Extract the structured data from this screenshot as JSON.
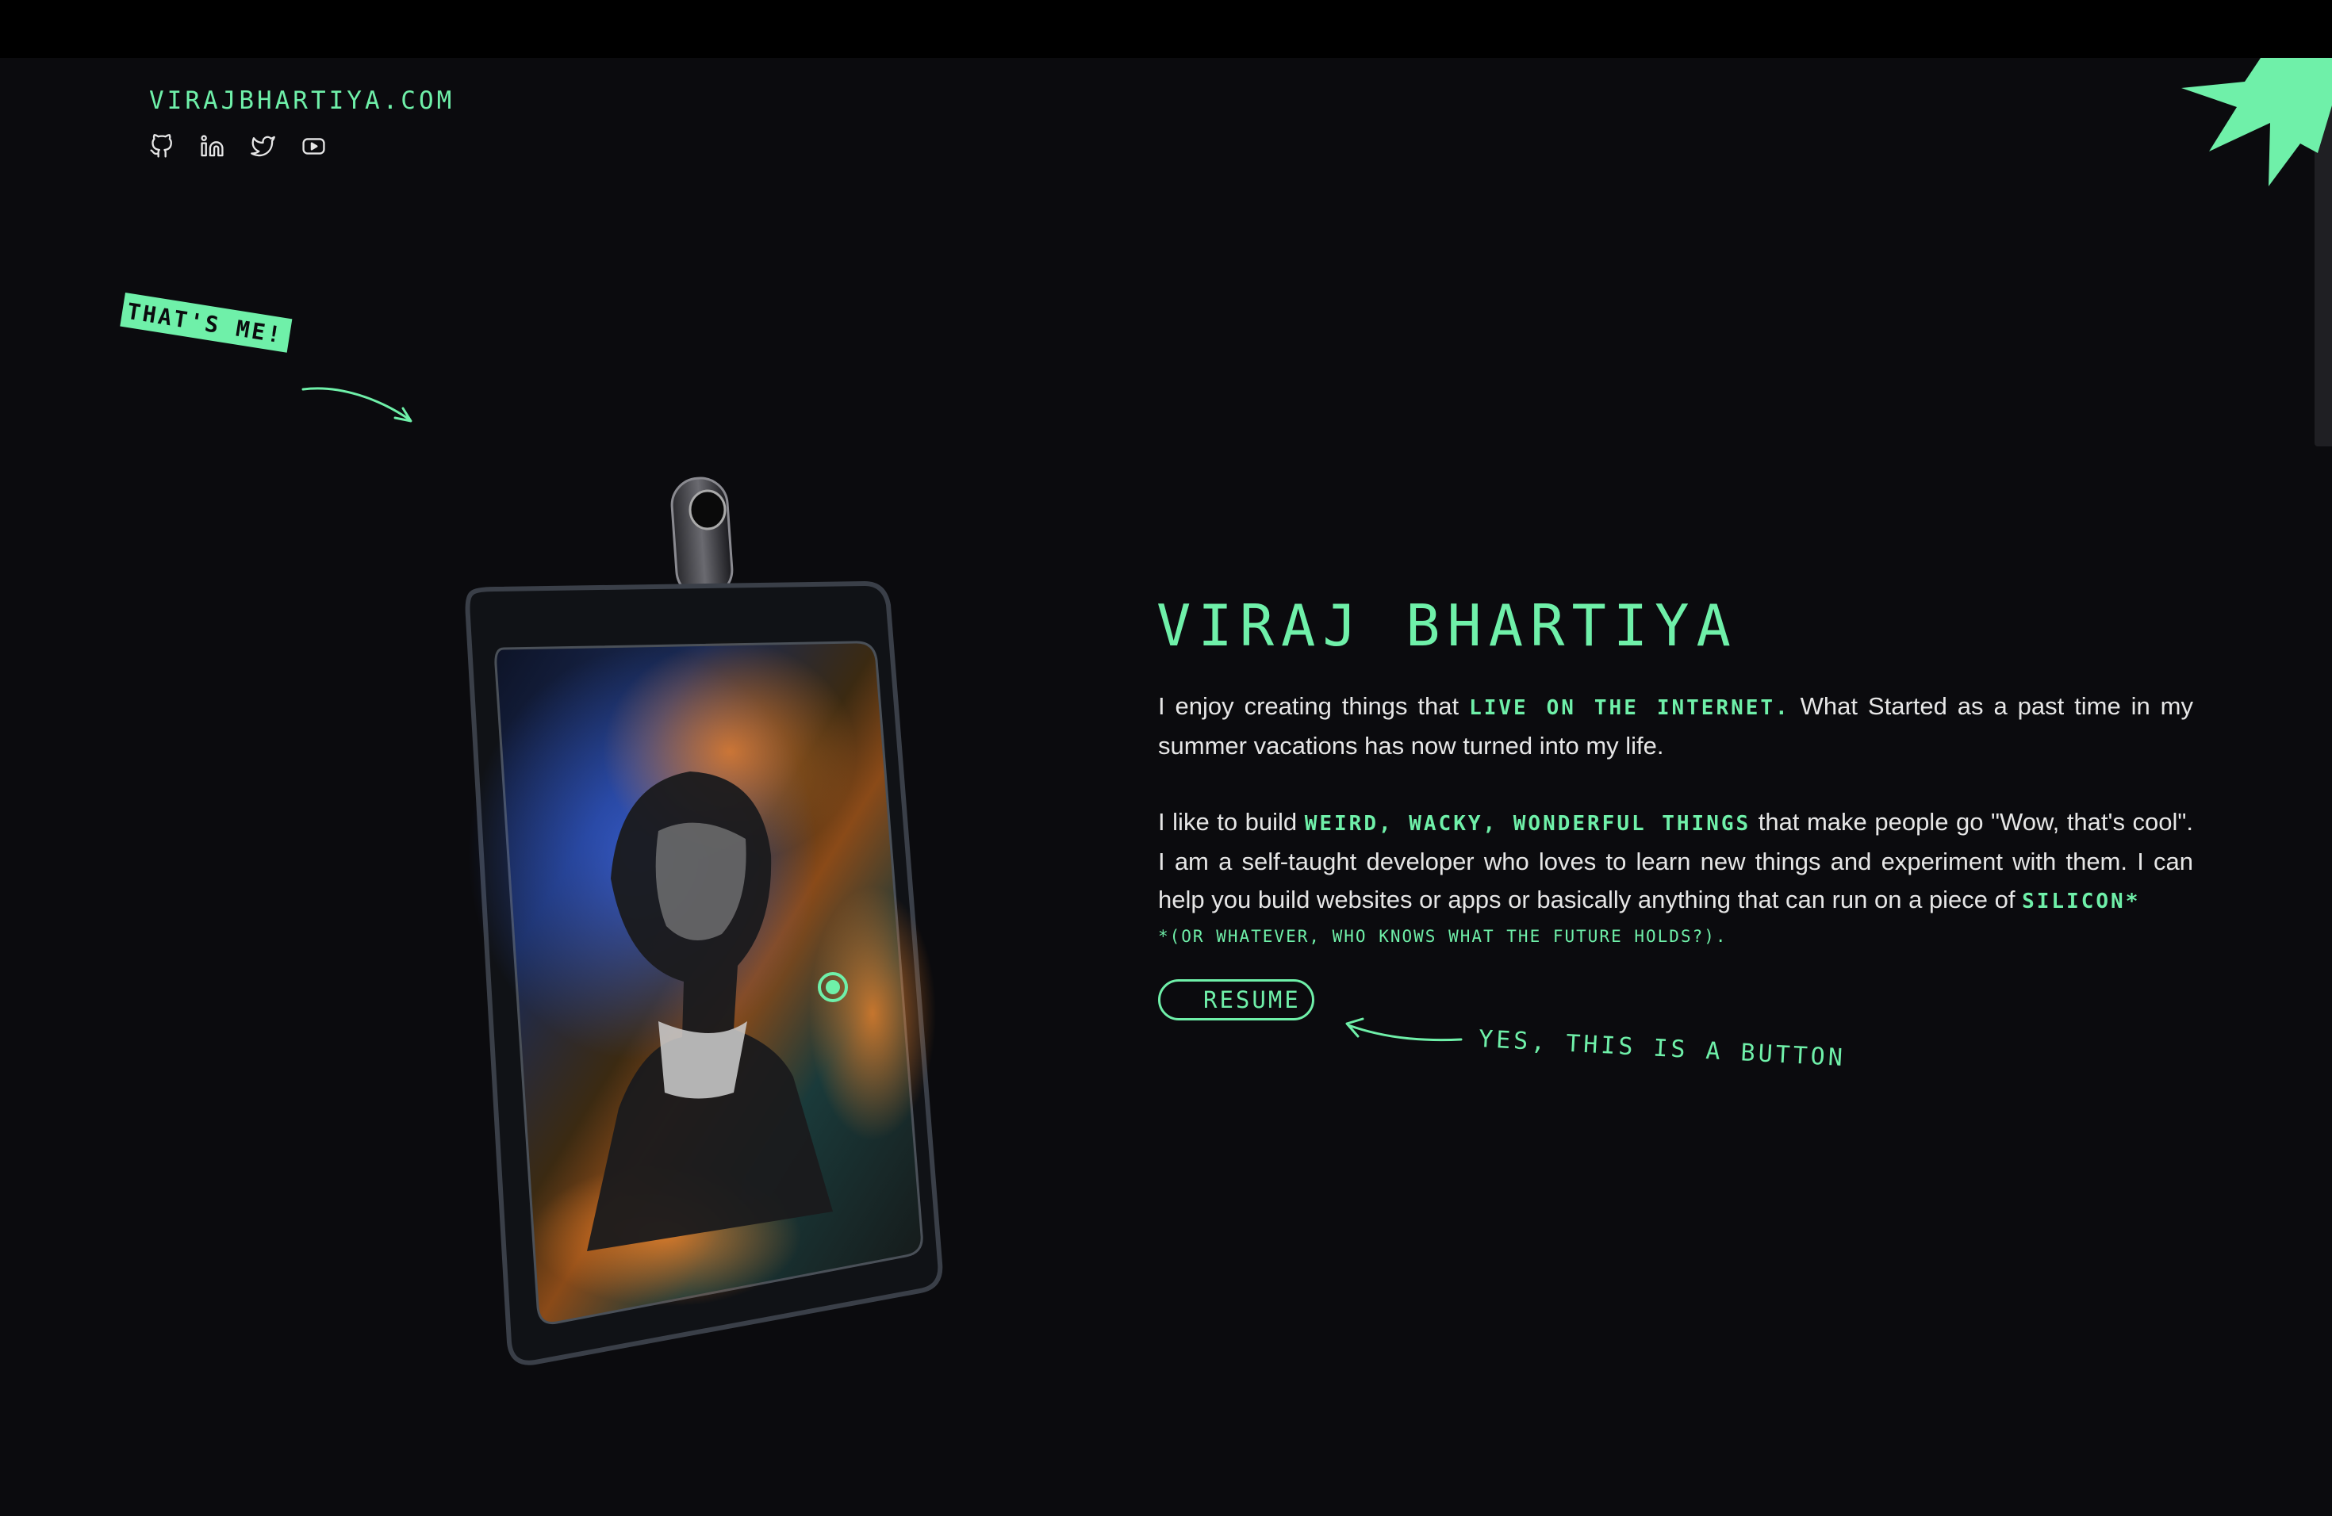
{
  "header": {
    "site_title": "VIRAJBHARTIYA.COM",
    "socials": [
      {
        "icon": "github-icon"
      },
      {
        "icon": "linkedin-icon"
      },
      {
        "icon": "twitter-icon"
      },
      {
        "icon": "youtube-icon"
      }
    ]
  },
  "annotations": {
    "thats_me": "THAT'S ME!",
    "button_note": "YES, THIS IS A BUTTON"
  },
  "intro": {
    "name": "VIRAJ BHARTIYA",
    "p1": {
      "before": "I enjoy creating things that ",
      "highlight": "LIVE ON THE INTERNET.",
      "after": "  What Started as a past time in my summer vacations has now turned into my life."
    },
    "p2": {
      "before": "I like to build ",
      "highlight": "WEIRD, WACKY, WONDERFUL THINGS",
      "middle": " that make people go \"Wow, that's cool\". I am a self-taught developer who loves to learn new things and experiment with them. I can help you build websites or apps or basically anything that can run on a piece of ",
      "highlight2": "SILICON*"
    },
    "footnote": "*(OR WHATEVER, WHO KNOWS WHAT THE FUTURE HOLDS?).",
    "resume_label": "RESUME"
  },
  "colors": {
    "accent": "#6ff0a9",
    "background": "#0b0b0e",
    "text": "#e6e6e6"
  }
}
